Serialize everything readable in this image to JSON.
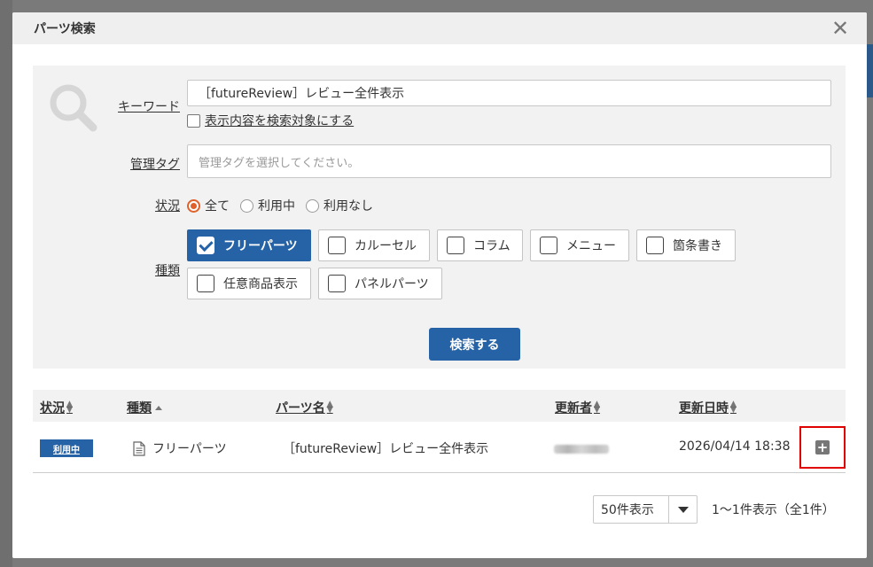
{
  "modal": {
    "title": "パーツ検索",
    "close_icon": "close-icon"
  },
  "search": {
    "keyword_label": "キーワード",
    "keyword_value": "［futureReview］レビュー全件表示",
    "include_display_label": "表示内容を検索対象にする",
    "include_display_checked": false,
    "tag_label": "管理タグ",
    "tag_placeholder": "管理タグを選択してください。",
    "status_label": "状況",
    "status_options": [
      "全て",
      "利用中",
      "利用なし"
    ],
    "status_selected": "全て",
    "type_label": "種類",
    "types": [
      {
        "label": "フリーパーツ",
        "checked": true
      },
      {
        "label": "カルーセル",
        "checked": false
      },
      {
        "label": "コラム",
        "checked": false
      },
      {
        "label": "メニュー",
        "checked": false
      },
      {
        "label": "箇条書き",
        "checked": false
      },
      {
        "label": "任意商品表示",
        "checked": false
      },
      {
        "label": "パネルパーツ",
        "checked": false
      }
    ],
    "search_button": "検索する"
  },
  "results": {
    "columns": [
      "状況",
      "種類",
      "パーツ名",
      "更新者",
      "更新日時"
    ],
    "rows": [
      {
        "status": "利用中",
        "type": "フリーパーツ",
        "name": "［futureReview］レビュー全件表示",
        "updated_at": "2026/04/14 18:38"
      }
    ]
  },
  "pager": {
    "per_page": "50件表示",
    "count_text": "1〜1件表示（全1件）"
  },
  "colors": {
    "primary": "#2563a6",
    "radio_accent": "#e0622a",
    "highlight": "#e00000"
  }
}
